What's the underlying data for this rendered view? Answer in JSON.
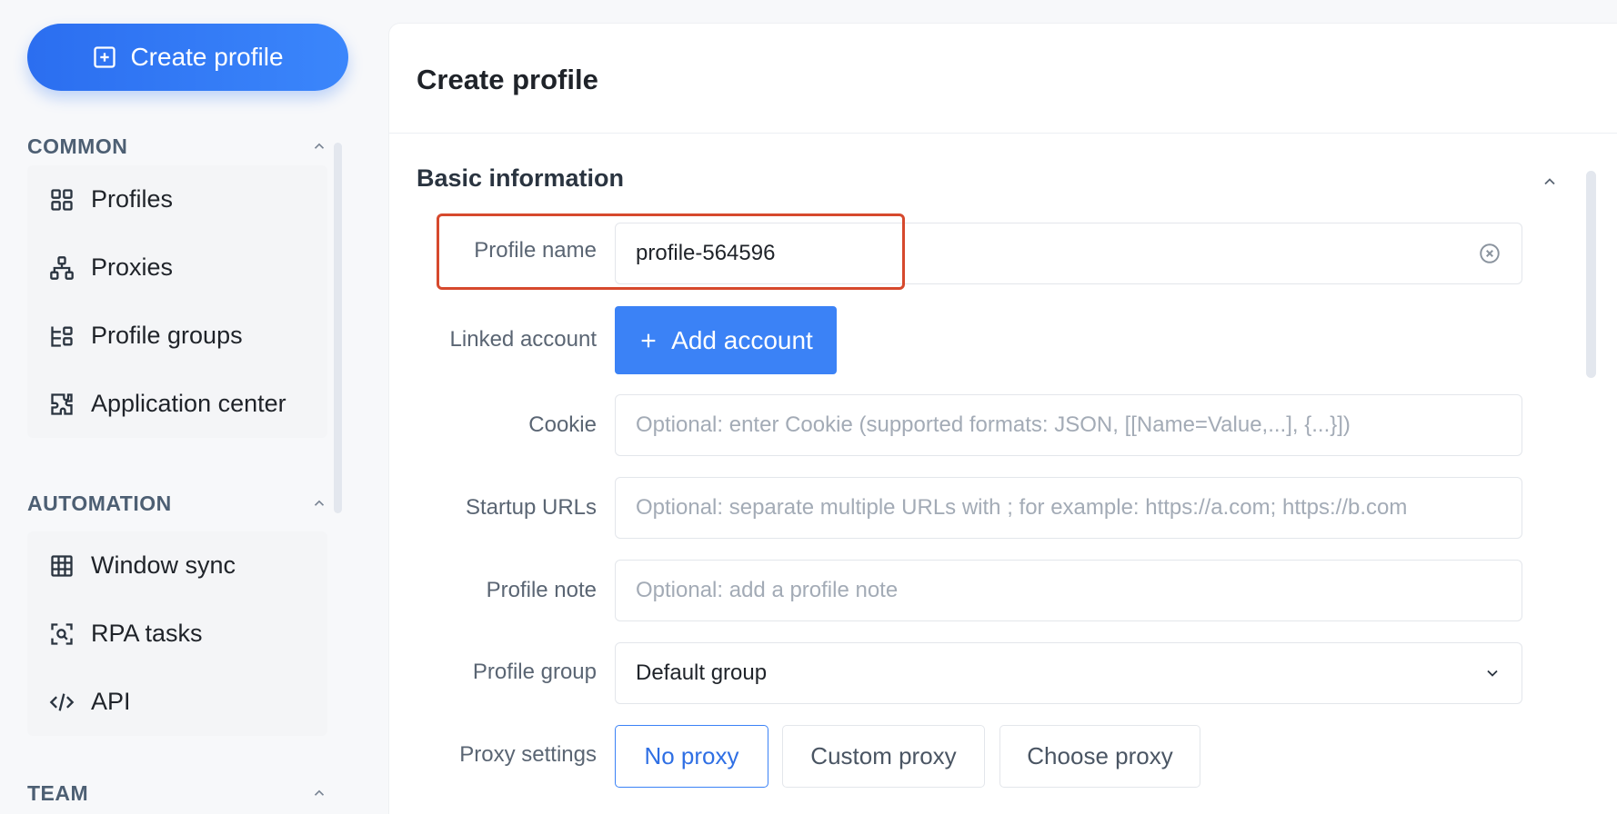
{
  "sidebar": {
    "create_button": "Create profile",
    "sections": [
      {
        "title": "COMMON",
        "items": [
          {
            "label": "Profiles",
            "icon": "grid-icon"
          },
          {
            "label": "Proxies",
            "icon": "network-icon"
          },
          {
            "label": "Profile groups",
            "icon": "groups-icon"
          },
          {
            "label": "Application center",
            "icon": "puzzle-icon"
          }
        ]
      },
      {
        "title": "AUTOMATION",
        "items": [
          {
            "label": "Window sync",
            "icon": "table-icon"
          },
          {
            "label": "RPA tasks",
            "icon": "scan-icon"
          },
          {
            "label": "API",
            "icon": "code-icon"
          }
        ]
      },
      {
        "title": "TEAM",
        "items": []
      }
    ]
  },
  "main": {
    "title": "Create profile",
    "section_title": "Basic information",
    "form": {
      "profile_name": {
        "label": "Profile name",
        "value": "profile-564596"
      },
      "linked_account": {
        "label": "Linked account",
        "button": "Add account"
      },
      "cookie": {
        "label": "Cookie",
        "placeholder": "Optional: enter Cookie (supported formats: JSON, [[Name=Value,...], {...}])"
      },
      "startup_urls": {
        "label": "Startup URLs",
        "placeholder": "Optional: separate multiple URLs with ; for example: https://a.com; https://b.com"
      },
      "profile_note": {
        "label": "Profile note",
        "placeholder": "Optional: add a profile note"
      },
      "profile_group": {
        "label": "Profile group",
        "value": "Default group"
      },
      "proxy_settings": {
        "label": "Proxy settings",
        "options": [
          "No proxy",
          "Custom proxy",
          "Choose proxy"
        ],
        "selected": "No proxy"
      }
    }
  },
  "colors": {
    "accent": "#3b82f6",
    "highlight": "#d6492d"
  }
}
